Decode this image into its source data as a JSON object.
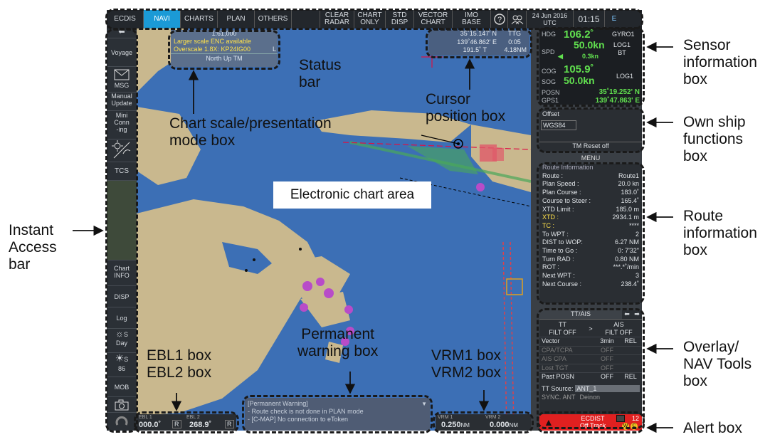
{
  "topbar": {
    "tabs": [
      "ECDIS",
      "NAVI",
      "CHARTS",
      "PLAN",
      "OTHERS"
    ],
    "active": "NAVI",
    "buttons": [
      "CLEAR\nRADAR",
      "CHART\nONLY",
      "STD\nDISP",
      "VECTOR\nCHART",
      "IMO\nBASE"
    ],
    "date": "24 Jun 2016\nUTC",
    "time": "01:15",
    "e_badge": "E"
  },
  "iab": {
    "items": [
      "Voyage",
      "MSG",
      "Manual\nUpdate",
      "Mini\nConn\n-ing",
      "TCS",
      "Chart\nINFO",
      "DISP",
      "Log",
      "Day",
      "86",
      "MOB"
    ],
    "day_letter": "S",
    "bright_letter": "S"
  },
  "scalebox": {
    "scale": "1:61,000",
    "line1": "Larger scale ENC available",
    "line2": "Overscale 1.8X: KP24IG00",
    "line3": "North Up TM",
    "mark": "L"
  },
  "cursorbox": {
    "lat": "35˚15.147' N",
    "lon": "139˚46.862' E",
    "brg": "191.5˚ T",
    "ttg_label": "TTG",
    "ttg": "0:05",
    "dist": "4.18NM"
  },
  "sensor": {
    "hdg_label": "HDG",
    "hdg": "106.2˚",
    "gyro": "GYRO1",
    "spd_label": "SPD",
    "spd": "50.0kn",
    "spd_src": "LOG1\nBT",
    "lateral": "0.3kn",
    "cog_label": "COG",
    "cog": "105.9˚",
    "sog_label": "SOG",
    "sog": "50.0kn",
    "sog_src": "LOG1",
    "posn_label": "POSN",
    "posn_src": "GPS1",
    "lat": "35˚19.252' N",
    "lon": "139˚47.863' E"
  },
  "ownship": {
    "offset": "Offset",
    "datum": "WGS84",
    "tm_reset": "TM Reset off",
    "menu": "MENU"
  },
  "route": {
    "title": "Route Information",
    "rows": [
      [
        "Route :",
        "Route1"
      ],
      [
        "Plan Speed :",
        "20.0 kn"
      ],
      [
        "Plan Course :",
        "183.0˚"
      ],
      [
        "Course to Steer :",
        "165.4˚"
      ],
      [
        "XTD Limit :",
        "185.0 m"
      ],
      [
        "XTD :",
        "2934.1 m"
      ],
      [
        "TC :",
        "****"
      ],
      [
        "To WPT :",
        "2"
      ],
      [
        "DIST to WOP:",
        "6.27 NM"
      ],
      [
        "Time to Go :",
        "0: 7'32\""
      ],
      [
        "Turn RAD :",
        "0.80 NM"
      ],
      [
        "ROT :",
        "***.*˚/min"
      ],
      [
        "Next WPT :",
        "3"
      ],
      [
        "Next Course :",
        "238.4˚"
      ]
    ]
  },
  "overlay": {
    "title": "TT/AIS",
    "tt": "TT",
    "tt_filt": "FILT OFF",
    "ais": "AIS",
    "ais_filt": "FILT OFF",
    "gt": ">",
    "rows": [
      [
        "Vector",
        "3min",
        "REL"
      ],
      [
        "CPA/TCPA",
        "OFF",
        ""
      ],
      [
        "AIS CPA",
        "OFF",
        ""
      ],
      [
        "Lost TGT",
        "OFF",
        ""
      ],
      [
        "Past POSN",
        "OFF",
        "REL"
      ]
    ],
    "source_label": "TT Source:",
    "source": "ANT_1",
    "sync": "SYNC. ANT",
    "sync_val": "Deinon"
  },
  "ebl": {
    "ebl1_label": "EBL 1",
    "ebl1": "000.0˚",
    "ebl2_label": "EBL 2",
    "ebl2": "268.9˚",
    "r": "R"
  },
  "vrm": {
    "vrm1_label": "VRM 1",
    "vrm1": "0.250",
    "vrm2_label": "VRM 2",
    "vrm2": "0.000",
    "unit": "NM"
  },
  "warning": {
    "title": "[Permanent Warning]",
    "line1": "- Route check is not done in PLAN mode",
    "line2": "- [C-MAP] No connection to eToken"
  },
  "alert": {
    "title": "ECDIST",
    "text": "Off Track",
    "count": "12",
    "w": "W",
    "c": "C"
  },
  "chart_area_label": "Electronic chart area",
  "callouts": {
    "status": "Status\nbar",
    "scale": "Chart scale/presentation\nmode box",
    "cursor": "Cursor\nposition box",
    "sensor": "Sensor\ninformation\nbox",
    "ownship": "Own ship\nfunctions\nbox",
    "route": "Route\ninformation\nbox",
    "overlay": "Overlay/\nNAV Tools\nbox",
    "alert": "Alert box",
    "iab": "Instant\nAccess\nbar",
    "ebl": "EBL1 box\nEBL2 box",
    "warning": "Permanent\nwarning box",
    "vrm": "VRM1 box\nVRM2 box"
  }
}
